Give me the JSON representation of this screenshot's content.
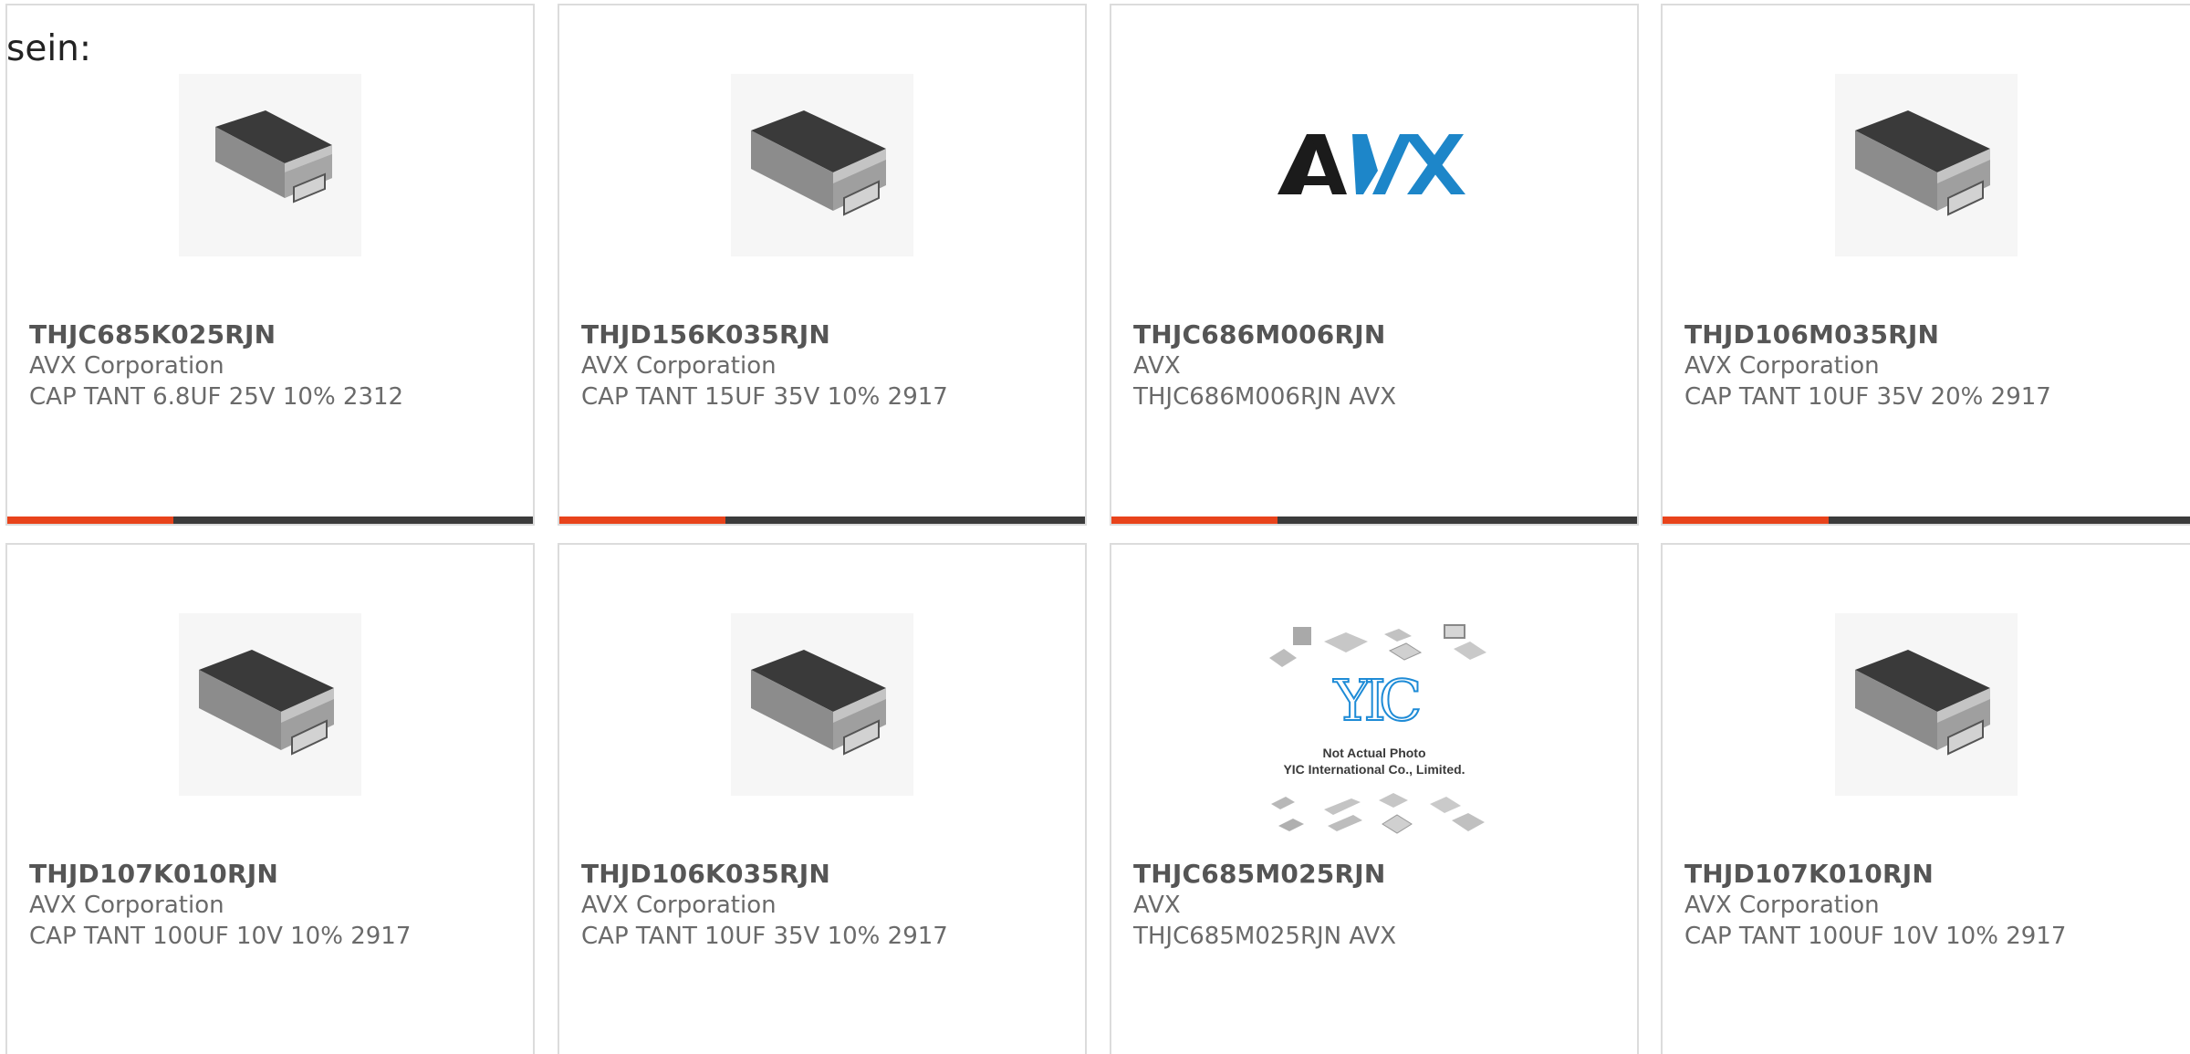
{
  "lead_text": "sein:",
  "colors": {
    "accent": "#e8431b",
    "bar": "#3b3b3b",
    "border": "#dcdcdc",
    "avx_black": "#1b1b1b",
    "avx_blue": "#1d86c9",
    "yic_blue": "#1e8bd6"
  },
  "products": [
    {
      "part": "THJC685K025RJN",
      "manufacturer": "AVX Corporation",
      "description": "CAP TANT 6.8UF 25V 10% 2312",
      "image": "tantalum-capacitor-icon"
    },
    {
      "part": "THJD156K035RJN",
      "manufacturer": "AVX Corporation",
      "description": "CAP TANT 15UF 35V 10% 2917",
      "image": "tantalum-capacitor-icon"
    },
    {
      "part": "THJC686M006RJN",
      "manufacturer": "AVX",
      "description": "THJC686M006RJN AVX",
      "image": "avx-logo",
      "logo_text": "AVX"
    },
    {
      "part": "THJD106M035RJN",
      "manufacturer": "AVX Corporation",
      "description": "CAP TANT 10UF 35V 20% 2917",
      "image": "tantalum-capacitor-icon"
    },
    {
      "part": "THJD107K010RJN",
      "manufacturer": "AVX Corporation",
      "description": "CAP TANT 100UF 10V 10% 2917",
      "image": "tantalum-capacitor-icon"
    },
    {
      "part": "THJD106K035RJN",
      "manufacturer": "AVX Corporation",
      "description": "CAP TANT 10UF 35V 10% 2917",
      "image": "tantalum-capacitor-icon"
    },
    {
      "part": "THJC685M025RJN",
      "manufacturer": "AVX",
      "description": "THJC685M025RJN AVX",
      "image": "yic-placeholder",
      "placeholder_line1": "Not Actual Photo",
      "placeholder_line2": "YIC International Co., Limited.",
      "placeholder_logo": "YIC"
    },
    {
      "part": "THJD107K010RJN",
      "manufacturer": "AVX Corporation",
      "description": "CAP TANT 100UF 10V 10% 2917",
      "image": "tantalum-capacitor-icon"
    }
  ]
}
